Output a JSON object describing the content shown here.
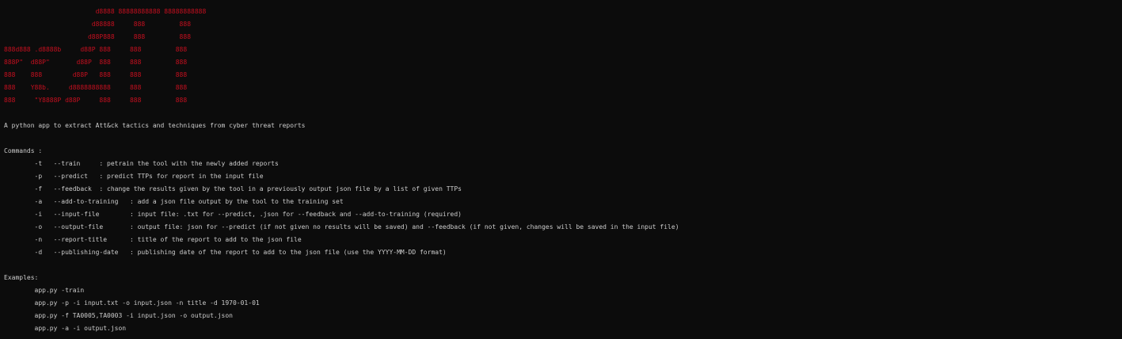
{
  "colors": {
    "background": "#0c0c0c",
    "text": "#cccccc",
    "banner": "#c50f1f"
  },
  "banner": [
    "                        d8888 88888888888 88888888888",
    "                       d88888     888         888",
    "                      d88P888     888         888",
    "888d888 .d8888b     d88P 888     888         888",
    "888P\"  d88P\"       d88P  888     888         888",
    "888    888        d88P   888     888         888",
    "888    Y88b.     d8888888888     888         888",
    "888     \"Y8888P d88P     888     888         888"
  ],
  "description": "A python app to extract Att&ck tactics and techniques from cyber threat reports",
  "commands_header": "Commands :",
  "commands": [
    "        -t   --train     : petrain the tool with the newly added reports",
    "        -p   --predict   : predict TTPs for report in the input file",
    "        -f   --feedback  : change the results given by the tool in a previously output json file by a list of given TTPs",
    "        -a   --add-to-training   : add a json file output by the tool to the training set",
    "        -i   --input-file        : input file: .txt for --predict, .json for --feedback and --add-to-training (required)",
    "        -o   --output-file       : output file: json for --predict (if not given no results will be saved) and --feedback (if not given, changes will be saved in the input file)",
    "        -n   --report-title      : title of the report to add to the json file",
    "        -d   --publishing-date   : publishing date of the report to add to the json file (use the YYYY-MM-DD format)"
  ],
  "examples_header": "Examples:",
  "examples": [
    "        app.py -train",
    "        app.py -p -i input.txt -o input.json -n title -d 1970-01-01",
    "        app.py -f TA0005,TA0003 -i input.json -o output.json",
    "        app.py -a -i output.json"
  ]
}
